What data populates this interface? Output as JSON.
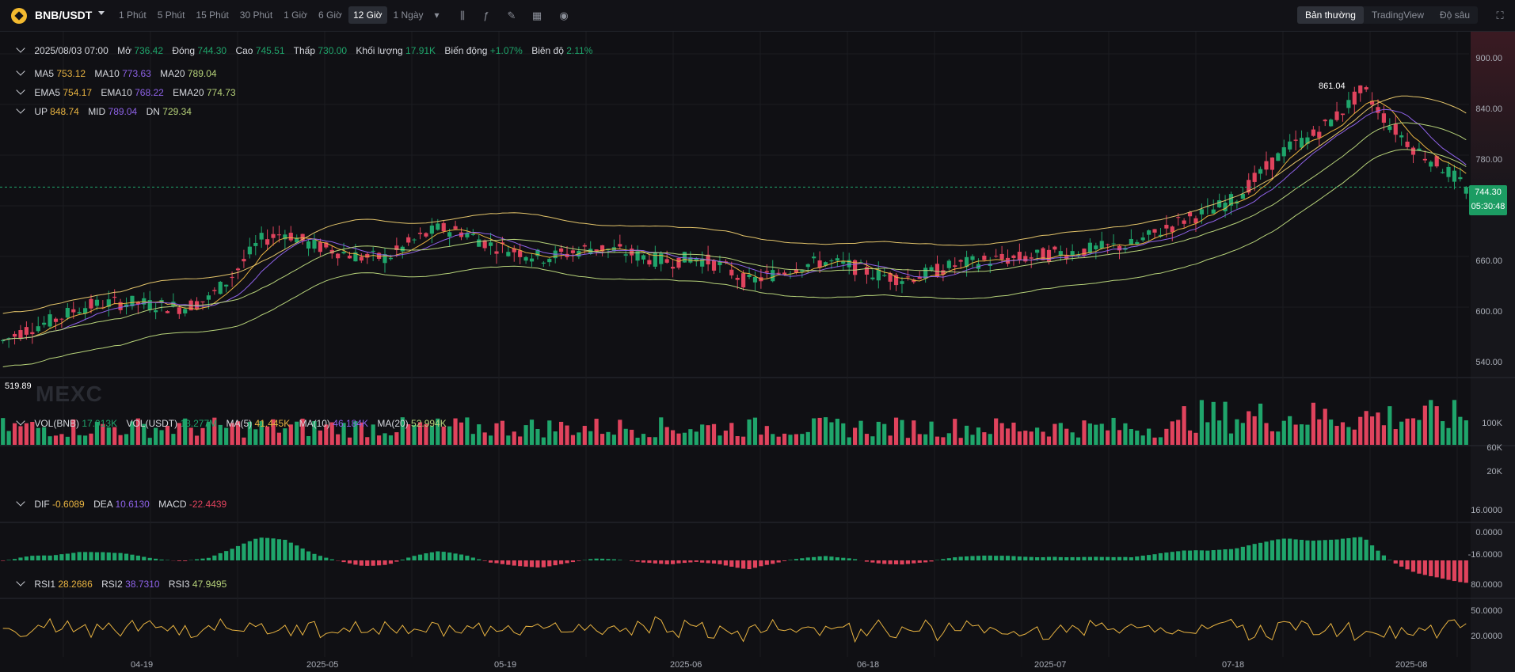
{
  "toolbar": {
    "pair": "BNB/USDT",
    "intervals": [
      "1 Phút",
      "5 Phút",
      "15 Phút",
      "30 Phút",
      "1 Giờ",
      "6 Giờ",
      "12 Giờ",
      "1 Ngày"
    ],
    "active_interval": "12 Giờ",
    "modes": [
      "Bản thường",
      "TradingView",
      "Độ sâu"
    ],
    "active_mode": "Bản thường"
  },
  "ohlc": {
    "date": "2025/08/03 07:00",
    "open_label": "Mở",
    "open": "736.42",
    "close_label": "Đóng",
    "close": "744.30",
    "high_label": "Cao",
    "high": "745.51",
    "low_label": "Thấp",
    "low": "730.00",
    "volume_label": "Khối lượng",
    "volume": "17.91K",
    "change_label": "Biến động",
    "change": "+1.07%",
    "amplitude_label": "Biên độ",
    "amplitude": "2.11%"
  },
  "ma": {
    "ma5_label": "MA5",
    "ma5": "753.12",
    "ma10_label": "MA10",
    "ma10": "773.63",
    "ma20_label": "MA20",
    "ma20": "789.04"
  },
  "ema": {
    "ema5_label": "EMA5",
    "ema5": "754.17",
    "ema10_label": "EMA10",
    "ema10": "768.22",
    "ema20_label": "EMA20",
    "ema20": "774.73"
  },
  "boll": {
    "up_label": "UP",
    "up": "848.74",
    "mid_label": "MID",
    "mid": "789.04",
    "dn_label": "DN",
    "dn": "729.34"
  },
  "vol": {
    "vol_label": "VOL(BNB)",
    "vol": "17.913K",
    "volu_label": "VOL(USDT)",
    "volu": "13.277M",
    "ma5_label": "MA(5)",
    "ma5": "41.445K",
    "ma10_label": "MA(10)",
    "ma10": "46.184K",
    "ma20_label": "MA(20)",
    "ma20": "52.994K"
  },
  "macd": {
    "dif_label": "DIF",
    "dif": "-0.6089",
    "dea_label": "DEA",
    "dea": "10.6130",
    "macd_label": "MACD",
    "macd": "-22.4439"
  },
  "rsi": {
    "rsi1_label": "RSI1",
    "rsi1": "28.2686",
    "rsi2_label": "RSI2",
    "rsi2": "38.7310",
    "rsi3_label": "RSI3",
    "rsi3": "47.9495"
  },
  "axes": {
    "price_ticks": [
      "900.00",
      "840.00",
      "780.00",
      "660.00",
      "600.00",
      "540.00"
    ],
    "volume_ticks": [
      "100K",
      "60K",
      "20K"
    ],
    "macd_ticks": [
      "16.0000",
      "0.0000",
      "-16.0000"
    ],
    "rsi_ticks": [
      "80.0000",
      "50.0000",
      "20.0000"
    ],
    "date_ticks": [
      "04-19",
      "2025-05",
      "05-19",
      "2025-06",
      "06-18",
      "2025-07",
      "07-18",
      "2025-08"
    ]
  },
  "annotations": {
    "high_marker": "861.04",
    "low_marker": "519.89",
    "last_price": "744.30",
    "countdown": "05:30:48",
    "watermark": "MEXC"
  },
  "colors": {
    "up": "#1fa56b",
    "down": "#e0435d",
    "ma5": "#e8b341",
    "ma10": "#8e62e8",
    "ma20": "#b7d37a",
    "boll": "#e3c46a"
  },
  "chart_data": {
    "type": "candlestick",
    "x_ticks": [
      "04-19",
      "2025-05",
      "05-19",
      "2025-06",
      "06-18",
      "2025-07",
      "07-18",
      "2025-08"
    ],
    "ylim": [
      519.89,
      900
    ],
    "trend_closes": [
      560,
      575,
      585,
      600,
      605,
      606,
      603,
      600,
      610,
      640,
      680,
      690,
      675,
      668,
      660,
      660,
      680,
      695,
      690,
      675,
      668,
      660,
      665,
      672,
      668,
      660,
      655,
      660,
      650,
      630,
      640,
      650,
      655,
      650,
      640,
      635,
      640,
      650,
      655,
      658,
      660,
      665,
      668,
      672,
      675,
      690,
      705,
      715,
      730,
      760,
      790,
      805,
      830,
      861,
      820,
      790,
      770,
      744.3
    ]
  }
}
